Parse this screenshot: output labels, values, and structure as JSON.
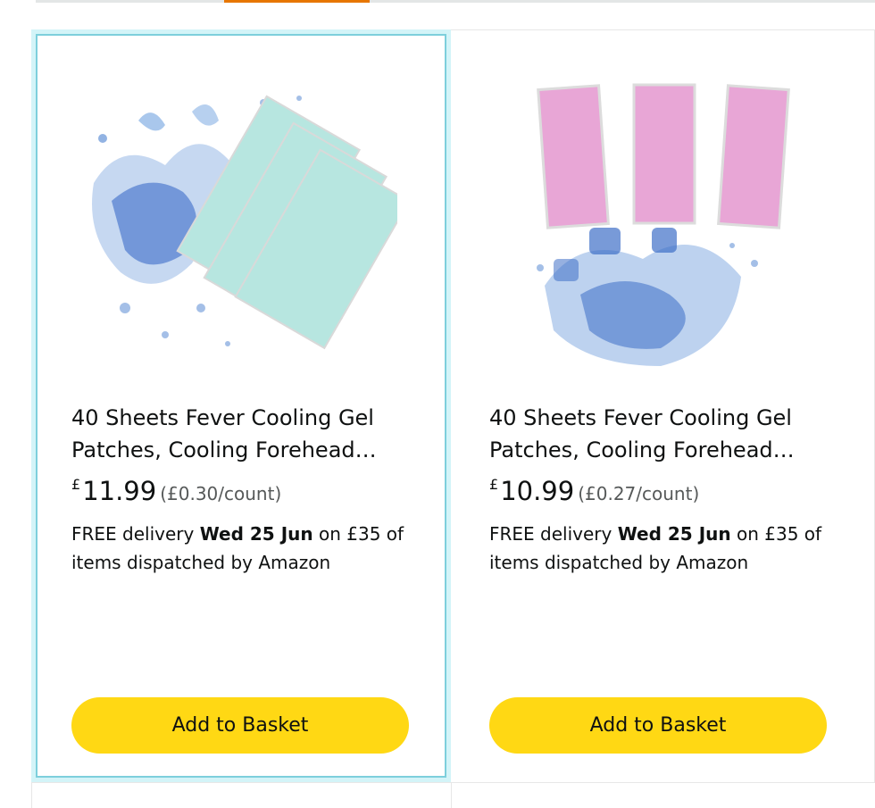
{
  "products": [
    {
      "title_line1": "40 Sheets Fever Cooling Gel",
      "title_line2": "Patches, Cooling Forehead…",
      "currency": "£",
      "price": "11.99",
      "unit_price": "(£0.30/count)",
      "delivery_prefix": "FREE delivery",
      "delivery_date": "Wed 25 Jun",
      "delivery_suffix": "on £35 of items dispatched by Amazon",
      "button_label": "Add to Basket",
      "patch_color": "#b7e6e0"
    },
    {
      "title_line1": "40 Sheets Fever Cooling Gel",
      "title_line2": "Patches, Cooling Forehead…",
      "currency": "£",
      "price": "10.99",
      "unit_price": "(£0.27/count)",
      "delivery_prefix": "FREE delivery",
      "delivery_date": "Wed 25 Jun",
      "delivery_suffix": "on £35 of items dispatched by Amazon",
      "button_label": "Add to Basket",
      "patch_color": "#e8a6d6"
    }
  ],
  "colors": {
    "button": "#ffd814",
    "tab_accent": "#e77600",
    "selected_border": "#7dcfdc"
  }
}
